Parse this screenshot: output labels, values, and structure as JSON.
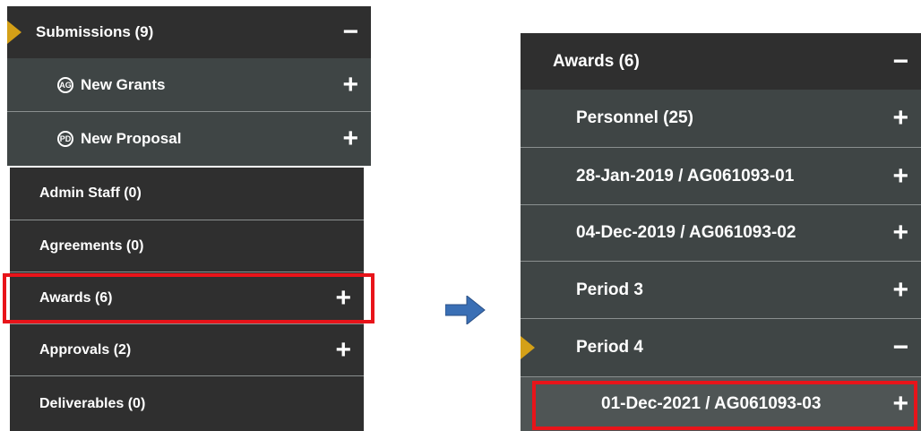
{
  "left_panel": {
    "submissions": {
      "label": "Submissions (9)",
      "toggle": "−",
      "children": [
        {
          "icon_text": "AG",
          "label": "New Grants",
          "toggle": "+"
        },
        {
          "icon_text": "PD",
          "label": "New Proposal",
          "toggle": "+"
        }
      ]
    },
    "items": [
      {
        "label": "Admin Staff (0)",
        "toggle": ""
      },
      {
        "label": "Agreements (0)",
        "toggle": ""
      },
      {
        "label": "Awards (6)",
        "toggle": "+"
      },
      {
        "label": "Approvals (2)",
        "toggle": "+"
      },
      {
        "label": "Deliverables (0)",
        "toggle": ""
      }
    ]
  },
  "right_panel": {
    "header": {
      "label": "Awards (6)",
      "toggle": "−"
    },
    "items": [
      {
        "label": "Personnel (25)",
        "toggle": "+"
      },
      {
        "label": "28-Jan-2019 / AG061093-01",
        "toggle": "+"
      },
      {
        "label": "04-Dec-2019 / AG061093-02",
        "toggle": "+"
      },
      {
        "label": "Period 3",
        "toggle": "+"
      },
      {
        "label": "Period 4",
        "toggle": "−"
      },
      {
        "label": "01-Dec-2021 / AG061093-03",
        "toggle": "+"
      }
    ]
  },
  "colors": {
    "highlight": "#e8141a",
    "pointer": "#d4a017",
    "arrow": "#3a6fb5"
  }
}
